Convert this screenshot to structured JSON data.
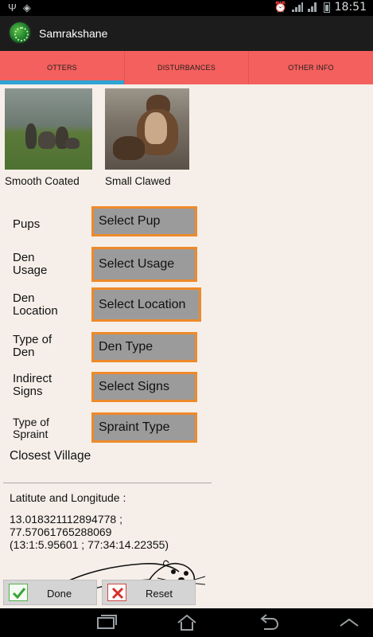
{
  "status_bar": {
    "time": "18:51",
    "left_icons": [
      "usb-icon",
      "sync-icon"
    ],
    "right_icons": [
      "alarm-icon",
      "signal-icon",
      "wifi-signal-icon",
      "battery-icon"
    ]
  },
  "app": {
    "title": "Samrakshane"
  },
  "tabs": [
    {
      "label": "OTTERS",
      "selected": true
    },
    {
      "label": "DISTURBANCES",
      "selected": false
    },
    {
      "label": "OTHER INFO",
      "selected": false
    }
  ],
  "otters": [
    {
      "caption": "Smooth Coated"
    },
    {
      "caption": "Small Clawed"
    }
  ],
  "form": {
    "pups": {
      "label": "Pups",
      "value": "Select Pup"
    },
    "den_usage": {
      "label_line1": "Den",
      "label_line2": "Usage",
      "value": "Select Usage"
    },
    "den_location": {
      "label_line1": "Den",
      "label_line2": "Location",
      "value": "Select Location"
    },
    "den_type": {
      "label_line1": "Type of",
      "label_line2": "Den",
      "value": "Den Type"
    },
    "indirect_signs": {
      "label_line1": "Indirect",
      "label_line2": "Signs",
      "value": "Select Signs"
    },
    "spraint_type": {
      "label_line1": "Type of",
      "label_line2": "Spraint",
      "value": "Spraint Type"
    },
    "closest_village": {
      "label": "Closest Village"
    }
  },
  "location": {
    "label": "Latitute and Longitude :",
    "line1": "13.018321112894778 ;",
    "line2": "77.57061765288069",
    "line3": "(13:1:5.95601 ; 77:34:14.22355)"
  },
  "buttons": {
    "done": "Done",
    "reset": "Reset"
  },
  "colors": {
    "tab_bar": "#f4605d",
    "tab_indicator": "#2fa3d3",
    "spinner_border": "#ee8a2a",
    "spinner_fill": "#9b9b9b",
    "background": "#f6efe9"
  }
}
